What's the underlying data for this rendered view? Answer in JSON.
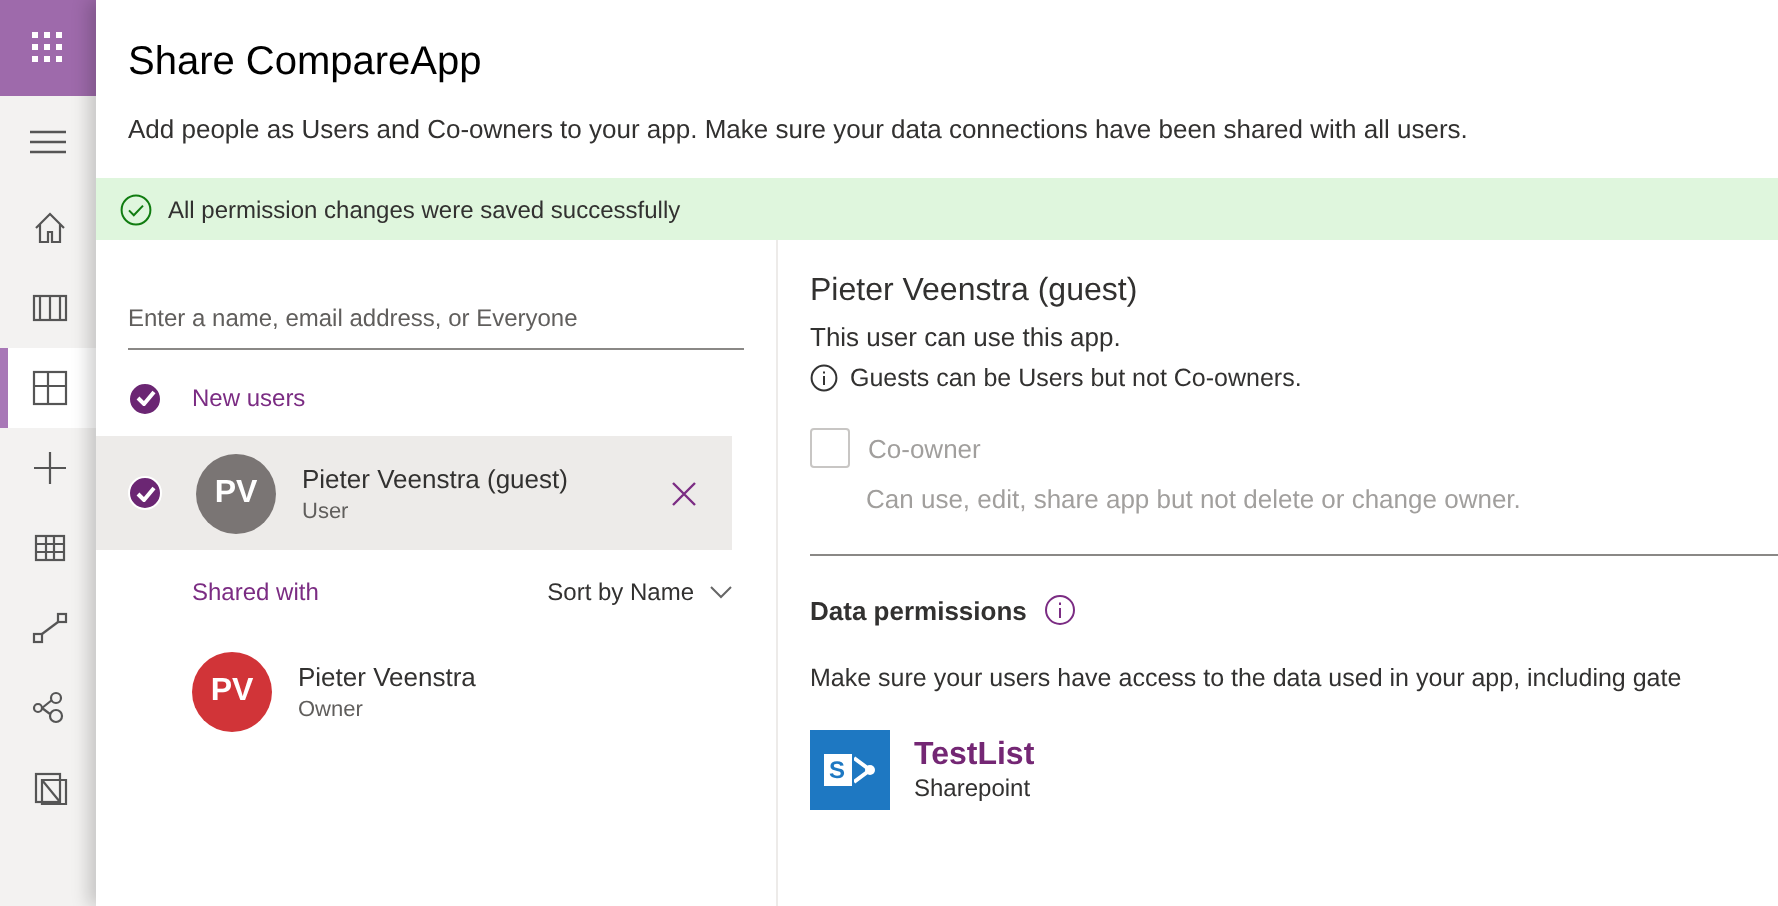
{
  "nav": {
    "items": [
      {
        "selected": false
      },
      {
        "selected": false
      },
      {
        "selected": true
      },
      {
        "selected": false
      },
      {
        "selected": false
      },
      {
        "selected": false
      },
      {
        "selected": false
      },
      {
        "selected": false
      }
    ]
  },
  "panel": {
    "title": "Share CompareApp",
    "description": "Add people as Users and Co-owners to your app. Make sure your data connections have been shared with all users.",
    "banner": "All permission changes were saved successfully"
  },
  "search": {
    "placeholder": "Enter a name, email address, or Everyone"
  },
  "new_users": {
    "label": "New users",
    "checked": true,
    "users": [
      {
        "initials": "PV",
        "color": "#7a7574",
        "name": "Pieter Veenstra (guest)",
        "role": "User",
        "checked": true,
        "selected": true
      }
    ]
  },
  "shared_with": {
    "label": "Shared with",
    "sort": "Sort by Name",
    "users": [
      {
        "initials": "PV",
        "color": "#d13438",
        "name": "Pieter Veenstra",
        "role": "Owner"
      }
    ]
  },
  "details": {
    "name": "Pieter Veenstra (guest)",
    "line": "This user can use this app.",
    "info": "Guests can be Users but not Co-owners.",
    "coowner": {
      "label": "Co-owner",
      "checked": false,
      "disabled": true,
      "hint": "Can use, edit, share app but not delete or change owner."
    },
    "data_title": "Data permissions",
    "data_text": "Make sure your users have access to the data used in your app, including gate",
    "sources": [
      {
        "logo_letter": "S",
        "name": "TestList",
        "type": "Sharepoint"
      }
    ]
  }
}
